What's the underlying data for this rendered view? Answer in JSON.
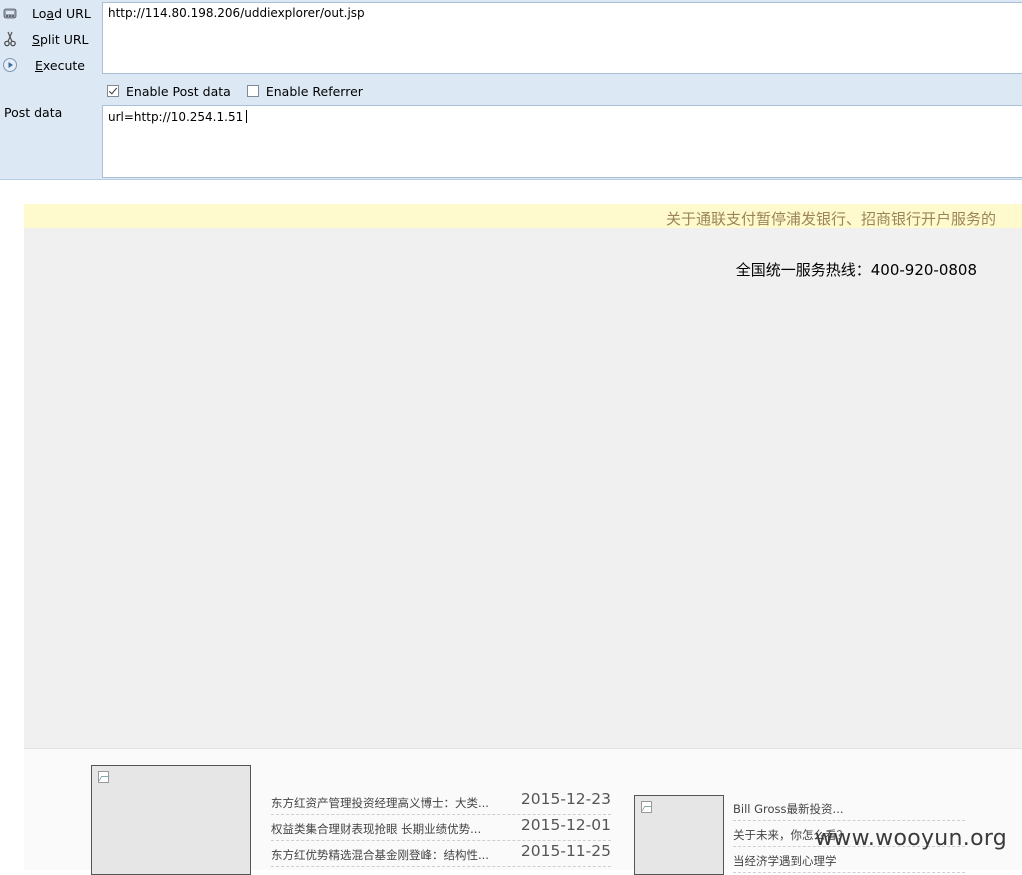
{
  "hackbar": {
    "actions": [
      {
        "label_pre": "Lo",
        "label_u": "a",
        "label_post": "d URL",
        "icon": "load-url-icon"
      },
      {
        "label_pre": "",
        "label_u": "S",
        "label_post": "plit URL",
        "icon": "scissors-icon"
      },
      {
        "label_pre": "",
        "label_u": "E",
        "label_post": "xecute",
        "icon": "play-icon"
      }
    ],
    "url_value": "http://114.80.198.206/uddiexplorer/out.jsp",
    "enable_post_label": "Enable Post data",
    "enable_post_checked": true,
    "enable_referrer_label": "Enable Referrer",
    "enable_referrer_checked": false,
    "post_label": "Post data",
    "post_value": "url=http://10.254.1.51"
  },
  "page": {
    "notice": "关于通联支付暂停浦发银行、招商银行开户服务的",
    "hotline": "全国统一服务热线：400-920-0808",
    "news": [
      {
        "title": "东方红资产管理投资经理高义博士：大类...",
        "date": "2015-12-23"
      },
      {
        "title": "权益类集合理财表现抢眼 长期业绩优势...",
        "date": "2015-12-01"
      },
      {
        "title": "东方红优势精选混合基金刚登峰：结构性...",
        "date": "2015-11-25"
      }
    ],
    "news2": [
      {
        "title": "Bill Gross最新投资..."
      },
      {
        "title": "关于未来，你怎么看？"
      },
      {
        "title": "当经济学遇到心理学"
      }
    ]
  },
  "watermark": "www.wooyun.org"
}
